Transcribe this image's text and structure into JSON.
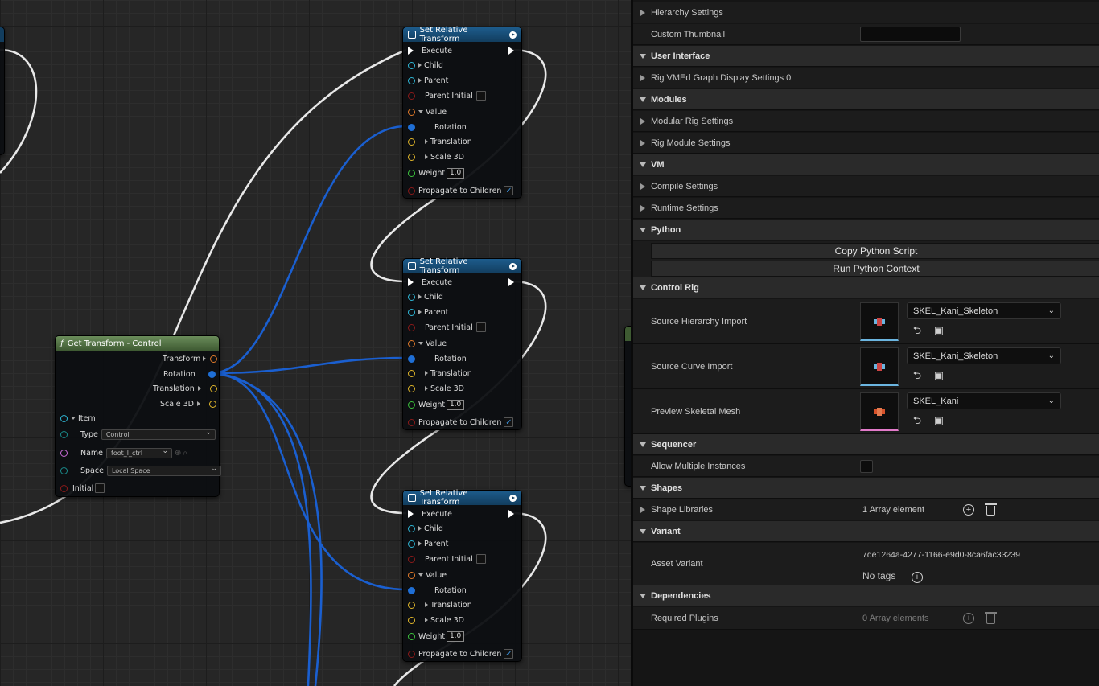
{
  "graph": {
    "srt_title": "Set Relative Transform",
    "srt_pins": {
      "execute": "Execute",
      "child": "Child",
      "parent": "Parent",
      "parent_initial": "Parent Initial",
      "value": "Value",
      "rotation": "Rotation",
      "translation": "Translation",
      "scale": "Scale 3D",
      "weight": "Weight",
      "weight_value": "1.0",
      "propagate": "Propagate to Children"
    },
    "gtc": {
      "title": "Get Transform - Control",
      "transform": "Transform",
      "rotation": "Rotation",
      "translation": "Translation",
      "scale": "Scale 3D",
      "item": "Item",
      "type_label": "Type",
      "type_value": "Control",
      "name_label": "Name",
      "name_value": "foot_l_ctrl",
      "space_label": "Space",
      "space_value": "Local Space",
      "initial": "Initial"
    },
    "pin_colors": {
      "exec": "#ffffff",
      "element": "#2fb7d6",
      "bool": "#8c1a1a",
      "transform": "#e07a2a",
      "rotation": "#1f6fd6",
      "vector": "#e0b62a",
      "float": "#3cc43c",
      "name": "#c86ad6"
    }
  },
  "panel": {
    "categories": {
      "user_interface": "User Interface",
      "modules": "Modules",
      "vm": "VM",
      "python": "Python",
      "control_rig": "Control Rig",
      "sequencer": "Sequencer",
      "shapes": "Shapes",
      "variant": "Variant",
      "dependencies": "Dependencies"
    },
    "props": {
      "hierarchy_settings": "Hierarchy Settings",
      "custom_thumbnail": "Custom Thumbnail",
      "rig_vmed": "Rig VMEd Graph Display Settings 0",
      "modular_rig_settings": "Modular Rig Settings",
      "rig_module_settings": "Rig Module Settings",
      "compile_settings": "Compile Settings",
      "runtime_settings": "Runtime Settings",
      "copy_python": "Copy Python Script",
      "run_python": "Run Python Context",
      "source_hierarchy_import": "Source Hierarchy Import",
      "source_hierarchy_value": "SKEL_Kani_Skeleton",
      "source_curve_import": "Source Curve Import",
      "source_curve_value": "SKEL_Kani_Skeleton",
      "preview_mesh": "Preview Skeletal Mesh",
      "preview_mesh_value": "SKEL_Kani",
      "allow_multiple": "Allow Multiple Instances",
      "shape_libraries": "Shape Libraries",
      "shape_libraries_value": "1 Array element",
      "asset_variant": "Asset Variant",
      "asset_variant_guid": "7de1264a-4277-1166-e9d0-8ca6fac33239",
      "no_tags": "No tags",
      "required_plugins": "Required Plugins",
      "required_plugins_value": "0 Array elements"
    }
  }
}
